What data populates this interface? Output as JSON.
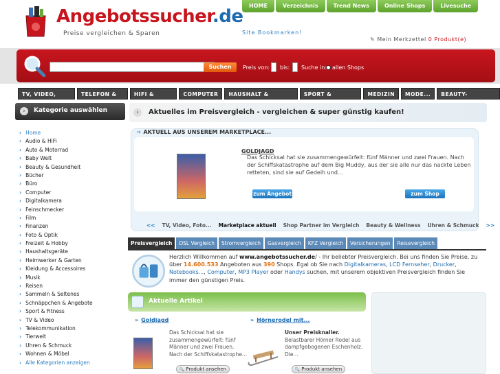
{
  "brand": {
    "logo_part1": "Angebots",
    "logo_part2": "sucher",
    "logo_part3": ".de",
    "tagline": "Preise vergleichen & Sparen",
    "accent": "#c8141c",
    "blue": "#1f6bb0",
    "green": "#6aab38"
  },
  "topnav": [
    "HOME",
    "Verzeichnis",
    "Trend News",
    "Online Shops",
    "Livesuche"
  ],
  "bookmark": "Site Bookmarken!",
  "merkzettel": {
    "label": "Mein Merkzettel",
    "count": "0 Produkt(e)"
  },
  "search": {
    "button": "Suchen",
    "price_from": "Preis von:",
    "price_to": "bis:",
    "search_in": "Suche in:",
    "all_shops": "allen Shops"
  },
  "categories": [
    "TV, VIDEO, FOTO",
    "TELEFON & CO",
    "HIFI & AUDIO",
    "COMPUTER",
    "HAUSHALT & WOHNEN",
    "SPORT & FREIZEIT",
    "MEDIZIN",
    "MODE...",
    "BEAUTY-WELLNESS"
  ],
  "sidebar": {
    "title": "Kategorie auswählen",
    "items": [
      "Home",
      "Audio & HiFi",
      "Auto & Motorrad",
      "Baby Welt",
      "Beauty & Gesundheit",
      "Bücher",
      "Büro",
      "Computer",
      "Digitalkamera",
      "Feinschmecker",
      "Film",
      "Finanzen",
      "Foto & Optik",
      "Freizeit & Hobby",
      "Haushaltsgeräte",
      "Heimwerker & Garten",
      "Kleidung & Accessoires",
      "Musik",
      "Reisen",
      "Sammeln & Seltenes",
      "Schnäppchen & Angebote",
      "Sport & Fitness",
      "TV & Video",
      "Telekommunikation",
      "Tierwelt",
      "Uhren & Schmuck",
      "Wohnen & Möbel",
      "Alle Kategorien anzeigen"
    ]
  },
  "main": {
    "headline": "Aktuelles im Preisvergleich - vergleichen & super günstig kaufen!",
    "marketplace": {
      "head": "AKTUELL AUS UNSEREM MARKETPLACE...",
      "title": "GOLDJAGD",
      "desc": "Das Schicksal hat sie zusammengewürfelt: fünf Männer und zwei Frauen. Nach der Schiffskatastrophe auf dem Big Muddy, aus der sie alle nur das nackte Leben retteten, sind sie auf Gedeih und...",
      "btn_offer": "zum Angebot",
      "btn_shop": "zum Shop",
      "tabs": [
        "<<",
        "TV, Video, Foto...",
        "Marketplace aktuell",
        "Shop Partner im Vergleich",
        "Beauty & Wellness",
        "Uhren & Schmuck",
        ">>"
      ]
    },
    "price_tabs": [
      "Preisvergleich",
      "DSL Vergleich",
      "Stromvergleich",
      "Gasvergleich",
      "KFZ Vergleich",
      "Versicherungen",
      "Reisevergleich"
    ],
    "info": {
      "t1": "Herzlich Willkommen auf ",
      "site": "www.angebotssucher.de",
      "t2": "/ - Ihr beliebter Preisvergleich. Bei uns finden Sie Preise, zu über ",
      "count": "14.600.533",
      "t3": " Angeboten aus ",
      "shops": "390",
      "t4": " Shops. Egal ob Sie nach ",
      "l1": "Digitalkameras",
      "l2": "LCD Fernseher",
      "l3": "Drucker",
      "l4": "Notebooks...",
      "l5": "Computer",
      "l6": "MP3 Player",
      "t5": " oder ",
      "l7": "Handys",
      "t6": " suchen, mit unserem objektiven Preisvergleich finden Sie immer den günstigen Preis."
    },
    "articles": {
      "title": "Aktuelle Artikel",
      "items": [
        {
          "title": "Goldjagd",
          "desc": "Das Schicksal hat sie zusammengewürfelt: fünf Männer und zwei Frauen. Nach der Schiffskatastrophe...",
          "btn": "Produkt ansehen"
        },
        {
          "title": "Hörnerodel mit...",
          "subtitle": "Unser Preisknaller.",
          "desc": "Belastbarer Hörner Rodel aus dampfgebogenen Eschenholz. Die...",
          "btn": "Produkt ansehen"
        }
      ]
    }
  }
}
